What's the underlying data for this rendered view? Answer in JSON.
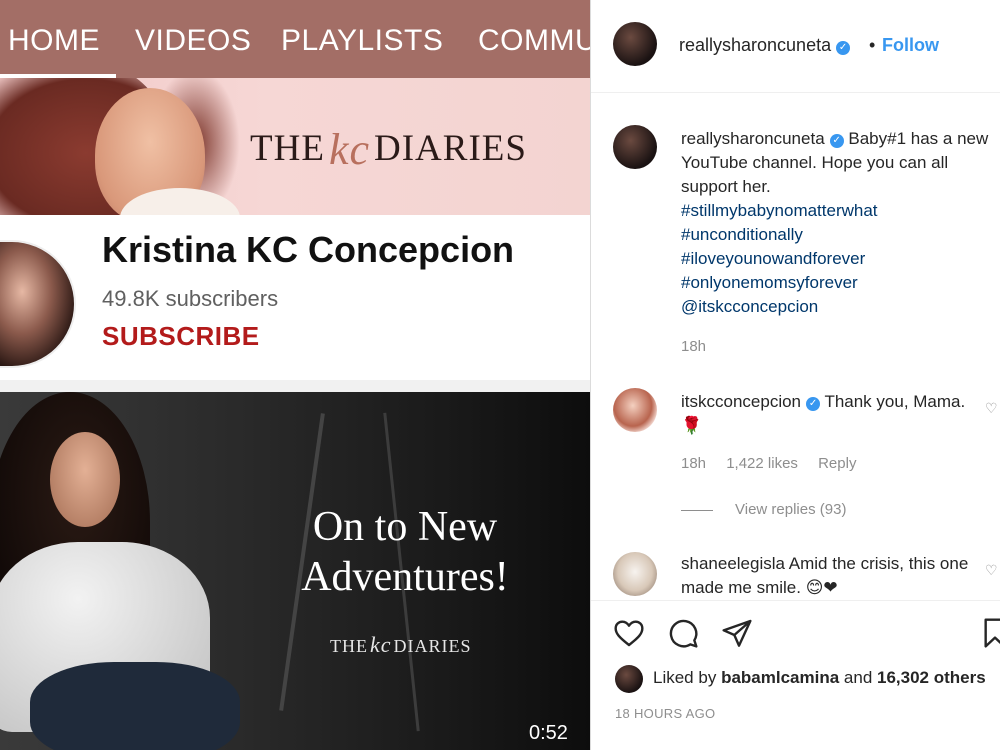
{
  "youtube": {
    "tabs": [
      "HOME",
      "VIDEOS",
      "PLAYLISTS",
      "COMMU"
    ],
    "banner_logo": {
      "left": "THE",
      "mark": "kc",
      "right": "DIARIES"
    },
    "channel": {
      "name": "Kristina KC Concepcion",
      "subscribers": "49.8K subscribers",
      "subscribe_label": "SUBSCRIBE"
    },
    "video": {
      "title_line1": "On to New",
      "title_line2": "Adventures!",
      "logo_left": "THE",
      "logo_mark": "kc",
      "logo_right": "DIARIES",
      "duration": "0:52"
    },
    "colors": {
      "tab_bar": "#a36e66",
      "subscribe": "#b31b1b"
    }
  },
  "instagram": {
    "header": {
      "username": "reallysharoncuneta",
      "separator": "•",
      "follow_label": "Follow"
    },
    "caption": {
      "username": "reallysharoncuneta",
      "text": "Baby#1 has a new YouTube channel. Hope you can all support her.",
      "hashtags": [
        "#stillmybabynomatterwhat",
        "#unconditionally",
        "#iloveyounowandforever",
        "#onlyonemomsyforever",
        "@itskcconcepcion"
      ],
      "time": "18h"
    },
    "comments": [
      {
        "username": "itskcconcepcion",
        "text": "Thank you, Mama. 🌹",
        "time": "18h",
        "likes": "1,422 likes",
        "reply_label": "Reply",
        "view_replies": "View replies (93)"
      },
      {
        "username": "shaneelegisla",
        "text": "Amid the crisis, this one made me smile. 😊❤"
      }
    ],
    "footer": {
      "liked_prefix": "Liked by",
      "liked_user": "babamlcamina",
      "liked_and": "and",
      "liked_others": "16,302 others",
      "post_time": "18 HOURS AGO"
    },
    "colors": {
      "link": "#3897f0",
      "hashtag": "#00376b",
      "muted": "#8e8e8e"
    }
  }
}
